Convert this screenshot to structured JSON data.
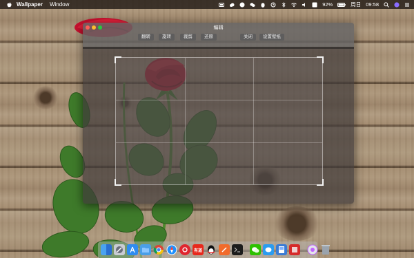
{
  "menubar": {
    "apple_icon": "apple-icon",
    "app_name": "Wallpaper",
    "menu": [
      "Window"
    ],
    "status": {
      "battery": "92%",
      "day": "周日",
      "time": "09:58"
    }
  },
  "window": {
    "title": "编辑",
    "buttons": {
      "flip": "翻转",
      "rotate": "旋转",
      "crop": "裁剪",
      "restore": "还原",
      "close": "关闭",
      "set_wallpaper": "设置壁纸"
    }
  },
  "dock": {
    "icons": [
      "finder-icon",
      "launchpad-icon",
      "app-store-icon",
      "folder-icon",
      "chrome-icon",
      "safari-icon",
      "netease-music-icon",
      "youdao-icon",
      "qq-icon",
      "sketch-icon",
      "terminal-icon",
      "wechat-icon",
      "wechat-work-icon",
      "preview-icon",
      "photo-booth-icon",
      "itunes-icon",
      "trash-icon"
    ],
    "youdao_label": "有道"
  },
  "colors": {
    "rose_red": "#d4142a",
    "leaf_green": "#3e7a2a",
    "wood": "#a58e72"
  }
}
